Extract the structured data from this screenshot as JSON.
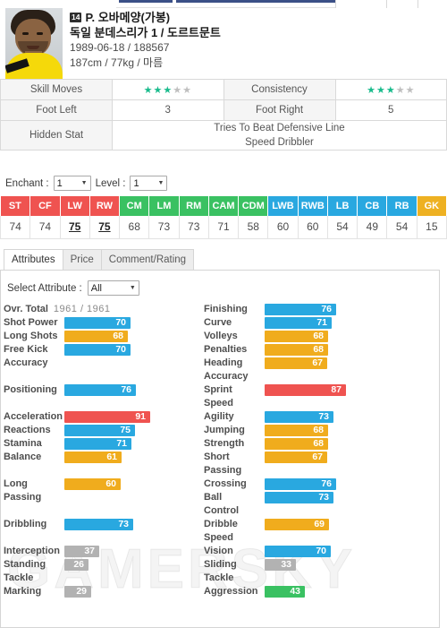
{
  "player": {
    "number": "14",
    "name": "P. 오바메양(가봉)",
    "club": "독일 분데스리가 1 / 도르트문트",
    "birth_id": "1989-06-18 / 188567",
    "body": "187cm / 77kg / 마름"
  },
  "skill_table": {
    "skill_moves_label": "Skill Moves",
    "skill_moves_stars": 3,
    "consistency_label": "Consistency",
    "consistency_stars": 3,
    "stars_max": 5,
    "foot_left_label": "Foot Left",
    "foot_left_value": "3",
    "foot_right_label": "Foot Right",
    "foot_right_value": "5",
    "hidden_stat_label": "Hidden Stat",
    "hidden_stat_line1": "Tries To Beat Defensive Line",
    "hidden_stat_line2": "Speed Dribbler"
  },
  "enchant": {
    "enchant_label": "Enchant :",
    "enchant_value": "1",
    "level_label": "Level :",
    "level_value": "1"
  },
  "positions": {
    "headers": [
      "ST",
      "CF",
      "LW",
      "RW",
      "CM",
      "LM",
      "RM",
      "CAM",
      "CDM",
      "LWB",
      "RWB",
      "LB",
      "CB",
      "RB",
      "GK"
    ],
    "values": [
      "74",
      "74",
      "75",
      "75",
      "68",
      "73",
      "73",
      "71",
      "58",
      "60",
      "60",
      "54",
      "49",
      "54",
      "15"
    ],
    "highlight": [
      false,
      false,
      true,
      true,
      false,
      false,
      false,
      false,
      false,
      false,
      false,
      false,
      false,
      false,
      false
    ],
    "colors": [
      "#ef5350",
      "#ef5350",
      "#ef5350",
      "#ef5350",
      "#3ac162",
      "#3ac162",
      "#3ac162",
      "#3ac162",
      "#3ac162",
      "#29a8e0",
      "#29a8e0",
      "#29a8e0",
      "#29a8e0",
      "#29a8e0",
      "#eeb122"
    ]
  },
  "tabs": [
    {
      "label": "Attributes",
      "active": true
    },
    {
      "label": "Price",
      "active": false
    },
    {
      "label": "Comment/Rating",
      "active": false
    }
  ],
  "select_attribute": {
    "label": "Select Attribute :",
    "value": "All"
  },
  "overall": {
    "label": "Ovr. Total",
    "value": "1961 / 1961"
  },
  "chart_data": {
    "type": "bar",
    "title": "Player Attributes",
    "xlabel": "",
    "ylabel": "",
    "xlim": [
      0,
      99
    ],
    "grid": false,
    "legend": "none",
    "color_map": {
      "blue": "#29a8e0",
      "orange": "#f0ac1d",
      "red": "#ef5350",
      "green": "#3ac162",
      "gray": "#b2b2b2"
    },
    "left_column": [
      {
        "name": "Shot Power",
        "value": 70,
        "color": "blue",
        "wrap": false
      },
      {
        "name": "Long Shots",
        "value": 68,
        "color": "orange",
        "wrap": false
      },
      {
        "name": "Free Kick Accuracy",
        "value": 70,
        "color": "blue",
        "wrap": true,
        "line1": "Free Kick",
        "line2": "Accuracy"
      },
      {
        "name": "__gap__",
        "value": null
      },
      {
        "name": "Positioning",
        "value": 76,
        "color": "blue",
        "wrap": false
      },
      {
        "name": "__gap__",
        "value": null
      },
      {
        "name": "Acceleration",
        "value": 91,
        "color": "red",
        "wrap": false
      },
      {
        "name": "Reactions",
        "value": 75,
        "color": "blue",
        "wrap": false
      },
      {
        "name": "Stamina",
        "value": 71,
        "color": "blue",
        "wrap": false
      },
      {
        "name": "Balance",
        "value": 61,
        "color": "orange",
        "wrap": false
      },
      {
        "name": "__gap__",
        "value": null
      },
      {
        "name": "Long Passing",
        "value": 60,
        "color": "orange",
        "wrap": true,
        "line1": "Long",
        "line2": "Passing"
      },
      {
        "name": "__gap__",
        "value": null
      },
      {
        "name": "Dribbling",
        "value": 73,
        "color": "blue",
        "wrap": false
      },
      {
        "name": "__gap__",
        "value": null
      },
      {
        "name": "Interception",
        "value": 37,
        "color": "gray",
        "wrap": false
      },
      {
        "name": "Standing Tackle",
        "value": 26,
        "color": "gray",
        "wrap": true,
        "line1": "Standing",
        "line2": "Tackle"
      },
      {
        "name": "Marking",
        "value": 29,
        "color": "gray",
        "wrap": false
      }
    ],
    "right_column": [
      {
        "name": "Finishing",
        "value": 76,
        "color": "blue",
        "wrap": false
      },
      {
        "name": "Curve",
        "value": 71,
        "color": "blue",
        "wrap": false
      },
      {
        "name": "Volleys",
        "value": 68,
        "color": "orange",
        "wrap": false
      },
      {
        "name": "Penalties",
        "value": 68,
        "color": "orange",
        "wrap": false
      },
      {
        "name": "Heading Accuracy",
        "value": 67,
        "color": "orange",
        "wrap": true,
        "line1": "Heading",
        "line2": "Accuracy"
      },
      {
        "name": "Sprint Speed",
        "value": 87,
        "color": "red",
        "wrap": true,
        "line1": "Sprint",
        "line2": "Speed"
      },
      {
        "name": "Agility",
        "value": 73,
        "color": "blue",
        "wrap": false
      },
      {
        "name": "Jumping",
        "value": 68,
        "color": "orange",
        "wrap": false
      },
      {
        "name": "Strength",
        "value": 68,
        "color": "orange",
        "wrap": false
      },
      {
        "name": "Short Passing",
        "value": 67,
        "color": "orange",
        "wrap": true,
        "line1": "Short",
        "line2": "Passing"
      },
      {
        "name": "Crossing",
        "value": 76,
        "color": "blue",
        "wrap": false
      },
      {
        "name": "Ball Control",
        "value": 73,
        "color": "blue",
        "wrap": true,
        "line1": "Ball",
        "line2": "Control"
      },
      {
        "name": "Dribble Speed",
        "value": 69,
        "color": "orange",
        "wrap": true,
        "line1": "Dribble",
        "line2": "Speed"
      },
      {
        "name": "Vision",
        "value": 70,
        "color": "blue",
        "wrap": false
      },
      {
        "name": "Sliding Tackle",
        "value": 33,
        "color": "gray",
        "wrap": true,
        "line1": "Sliding",
        "line2": "Tackle"
      },
      {
        "name": "Aggression",
        "value": 43,
        "color": "green",
        "wrap": false
      }
    ]
  },
  "watermark": "GAMERSKY"
}
